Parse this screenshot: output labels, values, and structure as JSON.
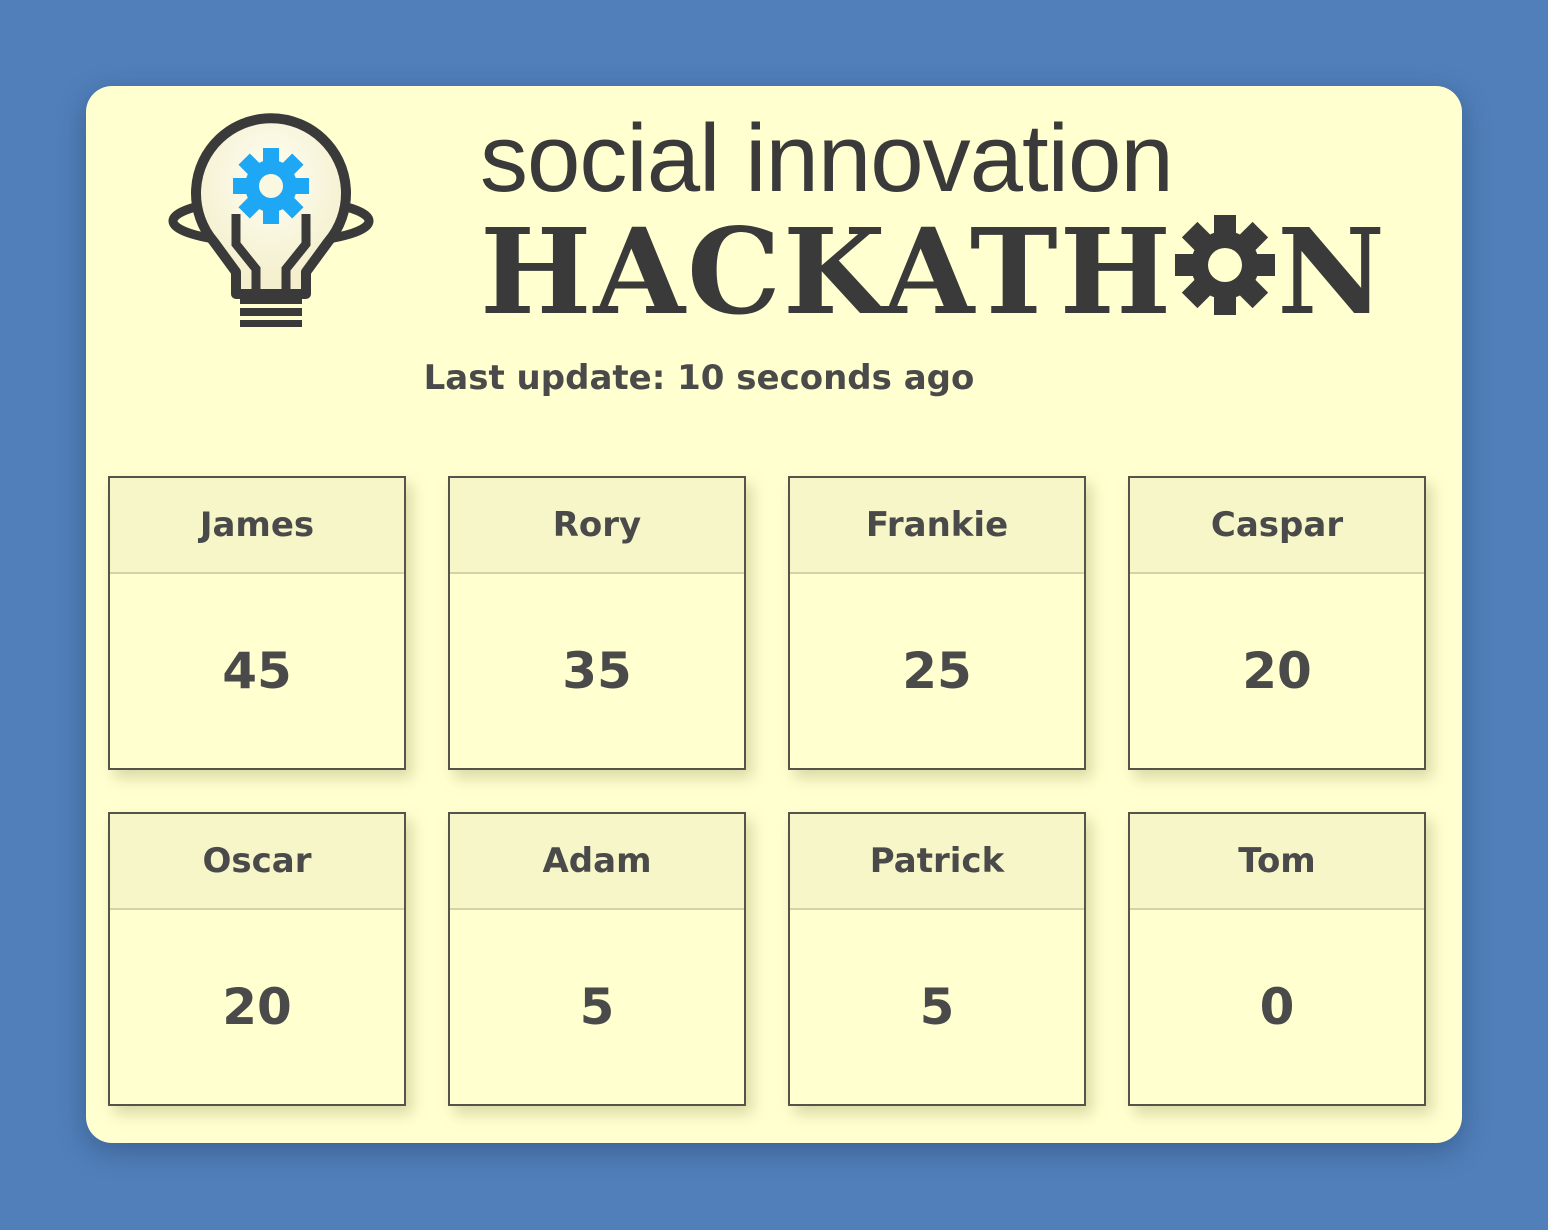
{
  "logo": {
    "line1": "social innovation",
    "line2_prefix": "HACKATH",
    "line2_suffix": "N",
    "icon": "lightbulb-gear-icon"
  },
  "status": {
    "last_update": "Last update: 10 seconds ago"
  },
  "colors": {
    "background": "#517fb9",
    "panel": "#ffffd0",
    "card_header": "#f6f6c8",
    "text": "#4a4a4a",
    "gear_accent": "#1ea7f5"
  },
  "leaderboard": [
    {
      "name": "James",
      "score": "45"
    },
    {
      "name": "Rory",
      "score": "35"
    },
    {
      "name": "Frankie",
      "score": "25"
    },
    {
      "name": "Caspar",
      "score": "20"
    },
    {
      "name": "Oscar",
      "score": "20"
    },
    {
      "name": "Adam",
      "score": "5"
    },
    {
      "name": "Patrick",
      "score": "5"
    },
    {
      "name": "Tom",
      "score": "0"
    }
  ]
}
